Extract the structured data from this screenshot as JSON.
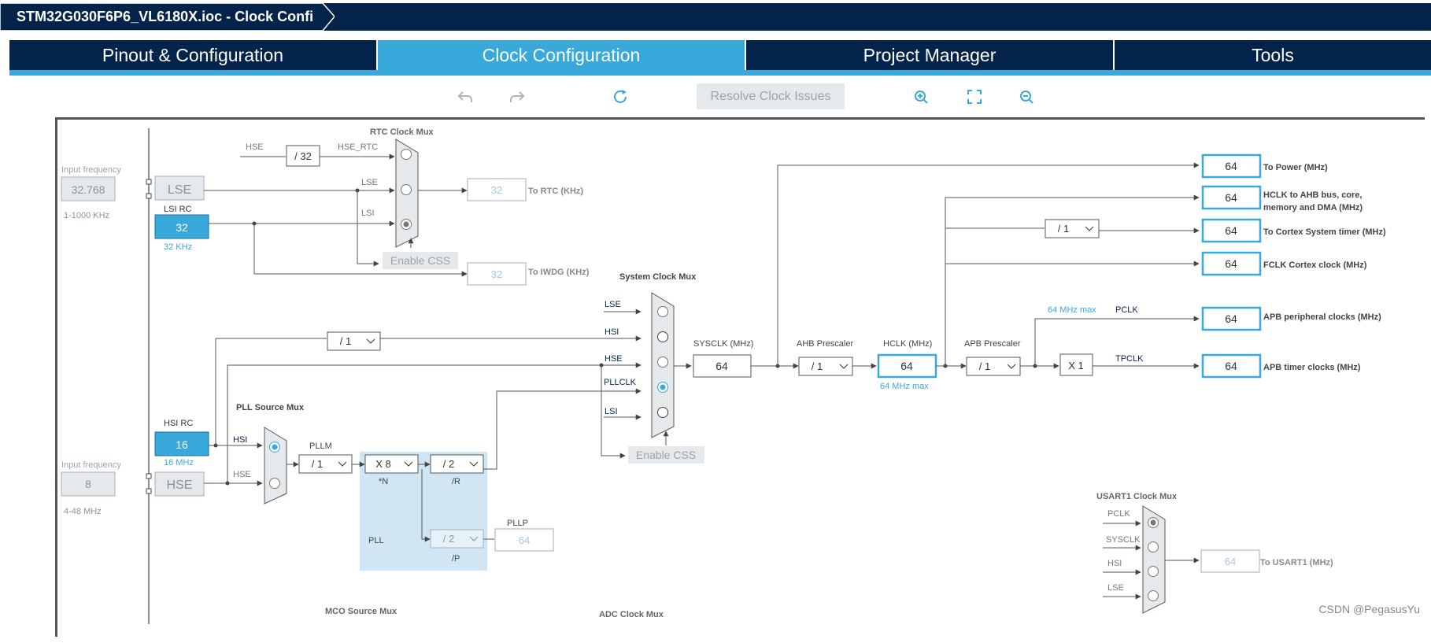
{
  "window": {
    "title": "STM32G030F6P6_VL6180X.ioc - Clock Confi"
  },
  "tabs": [
    {
      "label": "Pinout & Configuration",
      "active": false
    },
    {
      "label": "Clock Configuration",
      "active": true
    },
    {
      "label": "Project Manager",
      "active": false
    },
    {
      "label": "Tools",
      "active": false
    }
  ],
  "toolbar": {
    "resolve_label": "Resolve Clock Issues"
  },
  "colors": {
    "navy": "#03234b",
    "accent": "#39a9dc",
    "border": "#555555"
  },
  "lse": {
    "label": "LSE",
    "input_caption": "Input frequency",
    "input_value": "32.768",
    "range": "1-1000 KHz"
  },
  "lsi": {
    "title": "LSI RC",
    "value": "32",
    "freq": "32 KHz"
  },
  "hsi": {
    "title": "HSI RC",
    "value": "16",
    "freq": "16 MHz"
  },
  "hse": {
    "label": "HSE",
    "input_caption": "Input frequency",
    "input_value": "8",
    "range": "4-48 MHz"
  },
  "rtc": {
    "title": "RTC Clock Mux",
    "hse_label": "HSE",
    "div": "/ 32",
    "hse_rtc_label": "HSE_RTC",
    "lse_label": "LSE",
    "lsi_label": "LSI",
    "enable_css": "Enable CSS",
    "rtc_value": "32",
    "rtc_label": "To RTC (KHz)",
    "iwdg_value": "32",
    "iwdg_label": "To IWDG (KHz)"
  },
  "hsi_div": "/ 1",
  "pll": {
    "source_title": "PLL Source Mux",
    "hsi_label": "HSI",
    "hse_label": "HSE",
    "pllm_label": "PLLM",
    "pllm": "/ 1",
    "n": "X 8",
    "n_label": "*N",
    "r": "/ 2",
    "r_label": "/R",
    "p": "/ 2",
    "p_label": "/P",
    "pllp_label": "PLLP",
    "pllp_value": "64",
    "pll_label": "PLL"
  },
  "sysmux": {
    "title": "System Clock Mux",
    "inputs": [
      "LSE",
      "HSI",
      "HSE",
      "PLLCLK",
      "LSI"
    ],
    "enable_css": "Enable CSS",
    "sysclk_label": "SYSCLK (MHz)",
    "sysclk": "64"
  },
  "ahb": {
    "label": "AHB Prescaler",
    "value": "/ 1"
  },
  "hclk": {
    "label": "HCLK (MHz)",
    "value": "64",
    "max": "64 MHz max"
  },
  "apb": {
    "label": "APB Prescaler",
    "value": "/ 1"
  },
  "cortex_div": "/ 1",
  "x1": "X 1",
  "pclk_max": "64 MHz max",
  "pclk_label": "PCLK",
  "tpclk_label": "TPCLK",
  "outputs": [
    {
      "value": "64",
      "label": "To Power (MHz)"
    },
    {
      "value": "64",
      "label": "HCLK to AHB bus, core,",
      "label2": "memory and DMA (MHz)"
    },
    {
      "value": "64",
      "label": "To Cortex System timer (MHz)"
    },
    {
      "value": "64",
      "label": "FCLK Cortex clock (MHz)"
    },
    {
      "value": "64",
      "label": "APB peripheral clocks (MHz)"
    },
    {
      "value": "64",
      "label": "APB timer clocks (MHz)"
    }
  ],
  "usart": {
    "title": "USART1 Clock Mux",
    "inputs": [
      "PCLK",
      "SYSCLK",
      "HSI",
      "LSE"
    ],
    "value": "64",
    "label": "To USART1 (MHz)"
  },
  "mco_label": "MCO Source Mux",
  "adc_label": "ADC Clock Mux",
  "watermark": "CSDN @PegasusYu"
}
